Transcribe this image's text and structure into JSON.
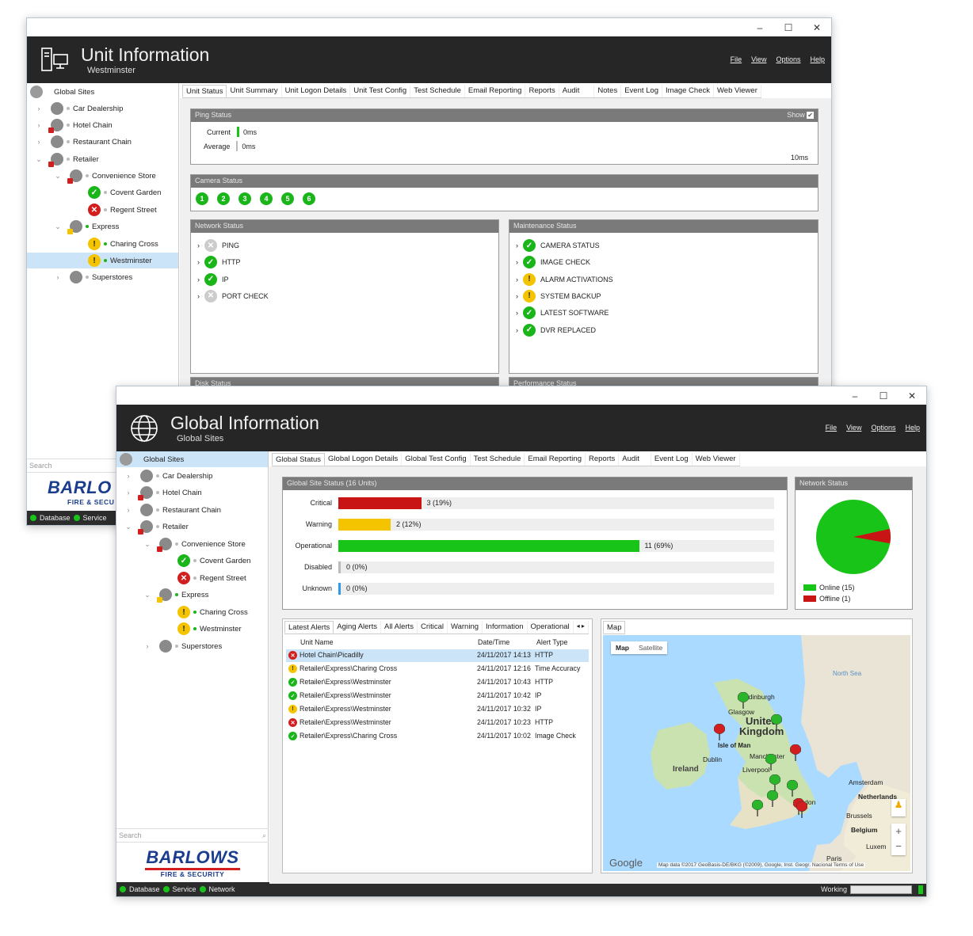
{
  "window_controls": {
    "minimize": "–",
    "maximize": "☐",
    "close": "✕"
  },
  "menu": [
    "File",
    "View",
    "Options",
    "Help"
  ],
  "unit": {
    "title": "Unit Information",
    "subtitle": "Westminster",
    "tabs": [
      "Unit Status",
      "Unit Summary",
      "Unit Logon Details",
      "Unit Test Config",
      "Test Schedule",
      "Email Reporting",
      "Reports",
      "Audit",
      "Notes",
      "Event Log",
      "Image Check",
      "Web Viewer"
    ],
    "ping": {
      "title": "Ping Status",
      "show_label": "Show",
      "current_label": "Current",
      "current_value": "0ms",
      "average_label": "Average",
      "average_value": "0ms",
      "scale_max": "10ms"
    },
    "camera": {
      "title": "Camera Status",
      "cameras": [
        "1",
        "2",
        "3",
        "4",
        "5",
        "6"
      ]
    },
    "network": {
      "title": "Network Status",
      "items": [
        {
          "label": "PING",
          "status": "na"
        },
        {
          "label": "HTTP",
          "status": "ok"
        },
        {
          "label": "IP",
          "status": "ok"
        },
        {
          "label": "PORT CHECK",
          "status": "na"
        }
      ]
    },
    "maintenance": {
      "title": "Maintenance Status",
      "items": [
        {
          "label": "CAMERA STATUS",
          "status": "ok"
        },
        {
          "label": "IMAGE CHECK",
          "status": "ok"
        },
        {
          "label": "ALARM ACTIVATIONS",
          "status": "wa"
        },
        {
          "label": "SYSTEM BACKUP",
          "status": "wa"
        },
        {
          "label": "LATEST SOFTWARE",
          "status": "ok"
        },
        {
          "label": "DVR REPLACED",
          "status": "ok"
        }
      ]
    },
    "disk_title": "Disk Status",
    "perf_title": "Performance Status",
    "search_placeholder": "Search",
    "status": [
      "Database",
      "Service"
    ]
  },
  "tree": {
    "root": "Global Sites",
    "items": {
      "car": "Car Dealership",
      "hotel": "Hotel Chain",
      "restaurant": "Restaurant Chain",
      "retailer": "Retailer",
      "convenience": "Convenience Store",
      "covent": "Covent Garden",
      "regent": "Regent Street",
      "express": "Express",
      "charing": "Charing Cross",
      "westminster": "Westminster",
      "superstores": "Superstores"
    }
  },
  "global": {
    "title": "Global Information",
    "subtitle": "Global Sites",
    "tabs": [
      "Global Status",
      "Global Logon Details",
      "Global Test Config",
      "Test Schedule",
      "Email Reporting",
      "Reports",
      "Audit",
      "Event Log",
      "Web Viewer"
    ],
    "site_status": {
      "title": "Global Site Status (16 Units)",
      "rows": [
        {
          "label": "Critical",
          "value": "3 (19%)",
          "fraction": 0.19,
          "color": "#c81414"
        },
        {
          "label": "Warning",
          "value": "2 (12%)",
          "fraction": 0.12,
          "color": "#f5c400"
        },
        {
          "label": "Operational",
          "value": "11 (69%)",
          "fraction": 0.69,
          "color": "#19c419"
        },
        {
          "label": "Disabled",
          "value": "0 (0%)",
          "fraction": 0,
          "color": "#bbbbbb"
        },
        {
          "label": "Unknown",
          "value": "0 (0%)",
          "fraction": 0,
          "color": "#2f9be8"
        }
      ]
    },
    "network_status": {
      "title": "Network Status",
      "online": "Online (15)",
      "offline": "Offline (1)",
      "online_count": 15,
      "offline_count": 1,
      "online_color": "#19c419",
      "offline_color": "#c81414"
    },
    "alert_tabs": [
      "Latest Alerts",
      "Aging Alerts",
      "All Alerts",
      "Critical",
      "Warning",
      "Information",
      "Operational"
    ],
    "alert_cols": [
      "Unit Name",
      "Date/Time",
      "Alert Type"
    ],
    "alerts": [
      {
        "status": "er",
        "unit": "Hotel Chain\\Picadilly",
        "time": "24/11/2017 14:13",
        "type": "HTTP"
      },
      {
        "status": "wa",
        "unit": "Retailer\\Express\\Charing Cross",
        "time": "24/11/2017 12:16",
        "type": "Time Accuracy"
      },
      {
        "status": "ok",
        "unit": "Retailer\\Express\\Westminster",
        "time": "24/11/2017 10:43",
        "type": "HTTP"
      },
      {
        "status": "ok",
        "unit": "Retailer\\Express\\Westminster",
        "time": "24/11/2017 10:42",
        "type": "IP"
      },
      {
        "status": "wa",
        "unit": "Retailer\\Express\\Westminster",
        "time": "24/11/2017 10:32",
        "type": "IP"
      },
      {
        "status": "er",
        "unit": "Retailer\\Express\\Westminster",
        "time": "24/11/2017 10:23",
        "type": "HTTP"
      },
      {
        "status": "ok",
        "unit": "Retailer\\Express\\Charing Cross",
        "time": "24/11/2017 10:02",
        "type": "Image Check"
      }
    ],
    "map": {
      "tab": "Map",
      "btn_map": "Map",
      "btn_sat": "Satellite",
      "labels": {
        "north_sea": "North Sea",
        "edinburgh": "Edinburgh",
        "glasgow": "Glasgow",
        "united": "United",
        "kingdom": "Kingdom",
        "isle": "Isle of Man",
        "dublin": "Dublin",
        "ireland": "Ireland",
        "manchester": "Manchester",
        "liverpool": "Liverpool",
        "amsterdam": "Amsterdam",
        "netherlands": "Netherlands",
        "brussels": "Brussels",
        "belgium": "Belgium",
        "luxem": "Luxem",
        "paris": "Paris",
        "london": "London"
      },
      "google": "Google",
      "attribution": "Map data ©2017 GeoBasis-DE/BKG (©2009), Google, Inst. Geogr. Nacional   Terms of Use",
      "zoom_in": "+",
      "zoom_out": "−"
    },
    "search_placeholder": "Search",
    "status": [
      "Database",
      "Service",
      "Network"
    ],
    "working": "Working"
  },
  "logo": {
    "brand": "BARLOWS",
    "tagline": "FIRE & SECURITY",
    "brand_partial": "BARLO",
    "tagline_partial": "FIRE & SECU"
  }
}
